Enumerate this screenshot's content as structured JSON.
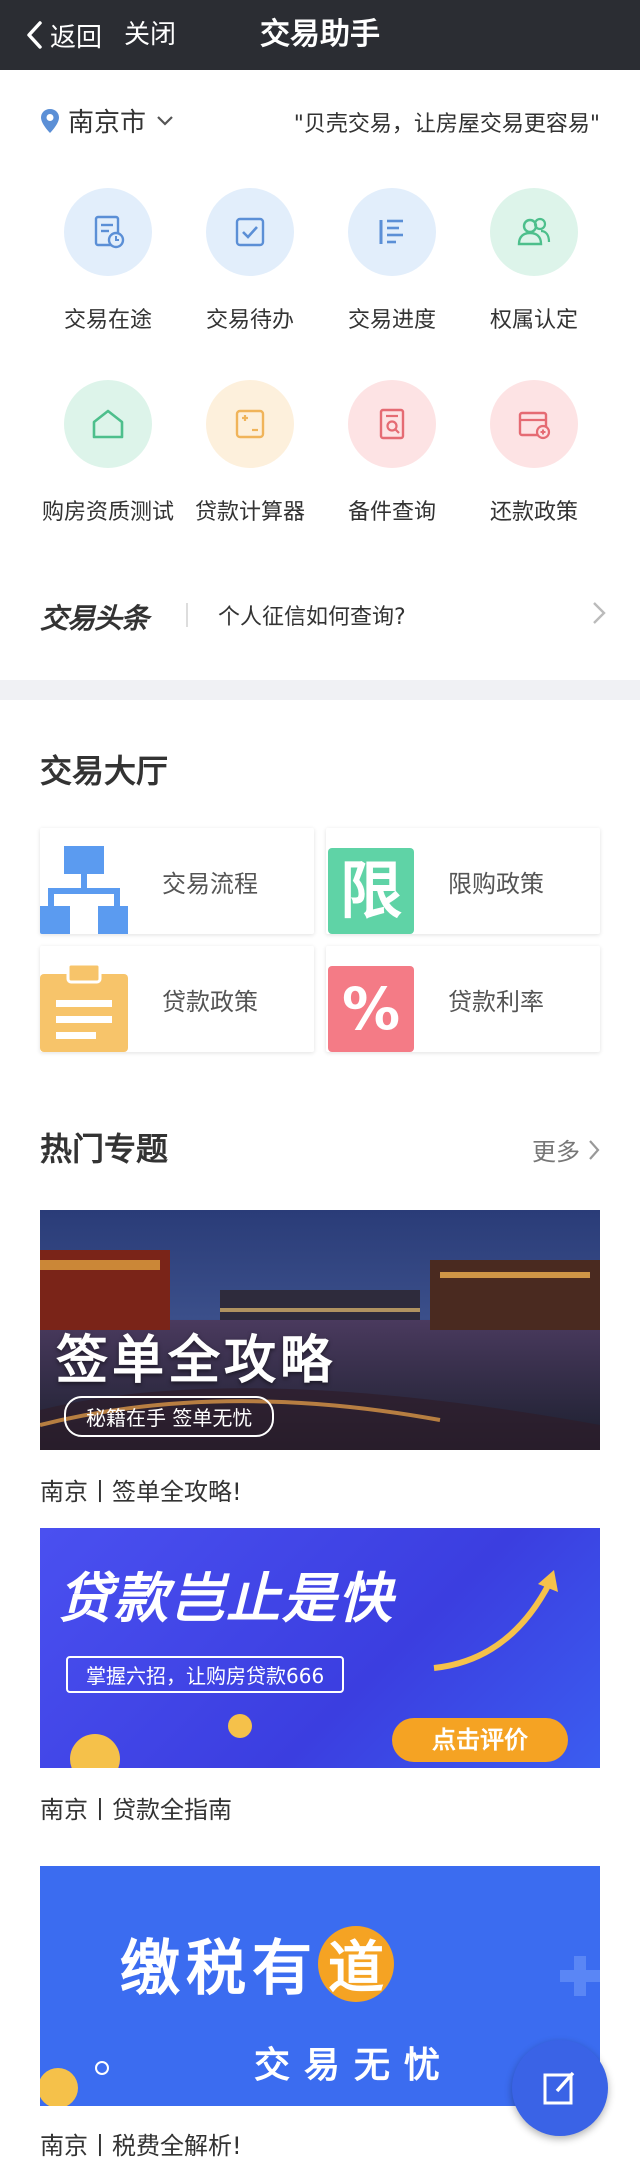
{
  "nav": {
    "back_label": "返回",
    "close_label": "关闭",
    "title": "交易助手"
  },
  "location": {
    "city": "南京市",
    "slogan": "\"贝壳交易，让房屋交易更容易\""
  },
  "colors": {
    "accent": "#3a63e6",
    "nav_bg": "#2b2d33"
  },
  "services": [
    {
      "label": "交易在途",
      "icon": "document-clock-icon",
      "bg": "#e2eefb",
      "fg": "#5b8fd6"
    },
    {
      "label": "交易待办",
      "icon": "checkbox-icon",
      "bg": "#e2eefb",
      "fg": "#5b8fd6"
    },
    {
      "label": "交易进度",
      "icon": "progress-lines-icon",
      "bg": "#e2eefb",
      "fg": "#5b8fd6"
    },
    {
      "label": "权属认定",
      "icon": "people-icon",
      "bg": "#ddf4ea",
      "fg": "#4dbf8c"
    },
    {
      "label": "购房资质测试",
      "icon": "house-icon",
      "bg": "#ddf4ea",
      "fg": "#4dbf8c"
    },
    {
      "label": "贷款计算器",
      "icon": "calculator-icon",
      "bg": "#fdf0dc",
      "fg": "#f0b45a"
    },
    {
      "label": "备件查询",
      "icon": "document-search-icon",
      "bg": "#fde3e4",
      "fg": "#e56b73"
    },
    {
      "label": "还款政策",
      "icon": "wallet-icon",
      "bg": "#fde3e4",
      "fg": "#e56b73"
    }
  ],
  "headline": {
    "brand": "交易头条",
    "text": "个人征信如何查询?"
  },
  "hall": {
    "title": "交易大厅",
    "cards": [
      {
        "label": "交易流程",
        "icon": "flowchart-icon"
      },
      {
        "label": "限购政策",
        "icon": "limit-badge-icon",
        "badge": "限"
      },
      {
        "label": "贷款政策",
        "icon": "clipboard-icon"
      },
      {
        "label": "贷款利率",
        "icon": "percent-icon",
        "badge": "%"
      }
    ]
  },
  "topics": {
    "title": "热门专题",
    "more_label": "更多",
    "items": [
      {
        "banner_title": "签单全攻略",
        "banner_sub": "秘籍在手 签单无忧",
        "caption": "南京丨签单全攻略!"
      },
      {
        "banner_title": "贷款岂止是快",
        "banner_sub": "掌握六招，让购房贷款666",
        "banner_button": "点击评价",
        "caption": "南京丨贷款全指南"
      },
      {
        "banner_title_a": "缴税有",
        "banner_title_b": "道",
        "banner_sub": "交易无忧",
        "caption": "南京丨税费全解析!"
      }
    ]
  }
}
